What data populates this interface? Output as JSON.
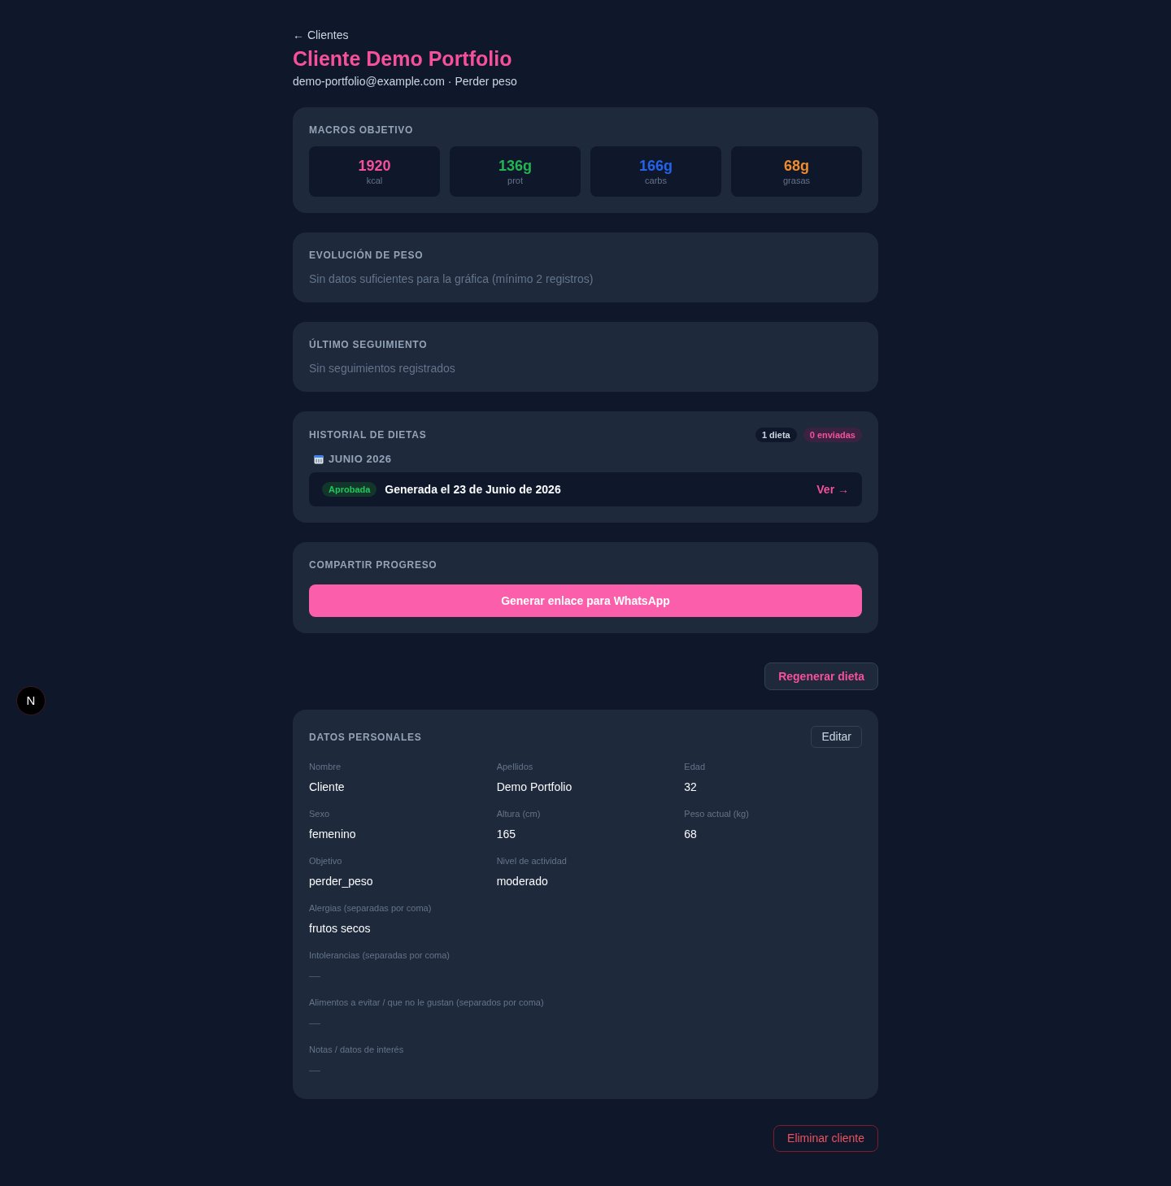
{
  "back_link": "← Clientes",
  "client": {
    "name": "Cliente Demo Portfolio",
    "subtitle": "demo-portfolio@example.com · Perder peso"
  },
  "macros": {
    "heading": "MACROS OBJETIVO",
    "items": [
      {
        "value": "1920",
        "unit": "kcal",
        "color": "#f7509a"
      },
      {
        "value": "136g",
        "unit": "prot",
        "color": "#22b552"
      },
      {
        "value": "166g",
        "unit": "carbs",
        "color": "#2563eb"
      },
      {
        "value": "68g",
        "unit": "grasas",
        "color": "#f08c2e"
      }
    ]
  },
  "weight": {
    "heading": "EVOLUCIÓN DE PESO",
    "empty_text": "Sin datos suficientes para la gráfica (mínimo 2 registros)"
  },
  "tracking": {
    "heading": "ÚLTIMO SEGUIMIENTO",
    "empty_text": "Sin seguimientos registrados"
  },
  "diet_history": {
    "heading": "HISTORIAL DE DIETAS",
    "badges": [
      {
        "label": "1 dieta",
        "kind": "count"
      },
      {
        "label": "0 enviadas",
        "kind": "sent"
      }
    ],
    "months": [
      {
        "label": "JUNIO 2026",
        "diets": [
          {
            "status": {
              "label": "Aprobada",
              "kind": "approved"
            },
            "title": "Generada el 23 de Junio de 2026",
            "link": "Ver →"
          }
        ]
      }
    ]
  },
  "share": {
    "heading": "COMPARTIR PROGRESO",
    "button": "Generar enlace para WhatsApp"
  },
  "regenerate_button": "Regenerar dieta",
  "personal": {
    "heading": "DATOS PERSONALES",
    "edit_button": "Editar",
    "fields": [
      {
        "label": "Nombre",
        "value": "Cliente"
      },
      {
        "label": "Apellidos",
        "value": "Demo Portfolio"
      },
      {
        "label": "Edad",
        "value": "32"
      },
      {
        "label": "Sexo",
        "value": "femenino"
      },
      {
        "label": "Altura (cm)",
        "value": "165"
      },
      {
        "label": "Peso actual (kg)",
        "value": "68"
      },
      {
        "label": "Objetivo",
        "value": "perder_peso"
      },
      {
        "label": "Nivel de actividad",
        "value": "moderado"
      }
    ],
    "long_fields": [
      {
        "label": "Alergias (separadas por coma)",
        "value": "frutos secos",
        "empty": false
      },
      {
        "label": "Intolerancias (separadas por coma)",
        "value": "—",
        "empty": true
      },
      {
        "label": "Alimentos a evitar / que no le gustan (separados por coma)",
        "value": "—",
        "empty": true
      },
      {
        "label": "Notas / datos de interés",
        "value": "—",
        "empty": true
      }
    ]
  },
  "delete_button": "Eliminar cliente",
  "dev_indicator": {
    "label": "N"
  }
}
